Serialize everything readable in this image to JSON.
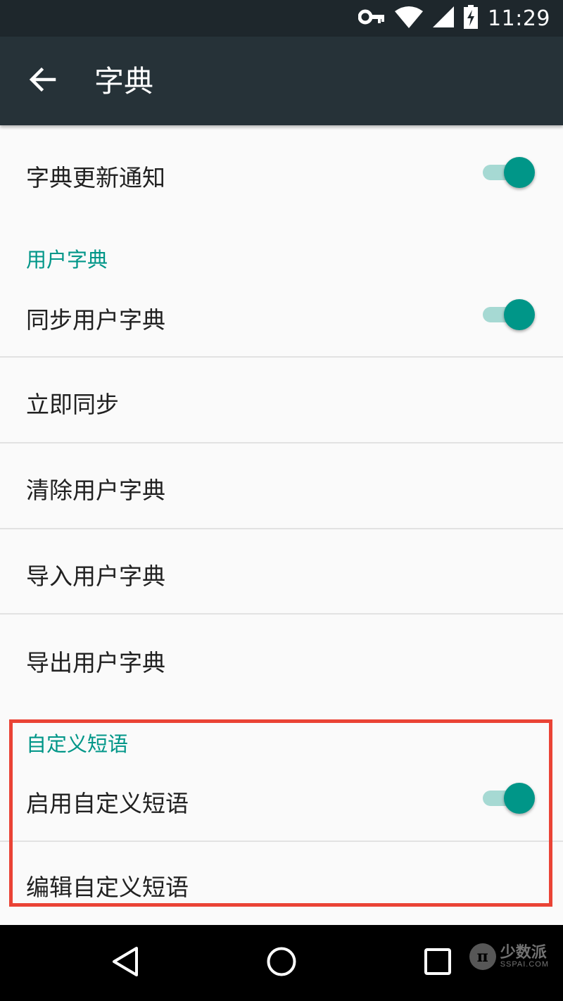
{
  "status_bar": {
    "time": "11:29",
    "icons": [
      "vpn-key-icon",
      "wifi-icon",
      "cell-signal-icon",
      "battery-charging-icon"
    ]
  },
  "app_bar": {
    "title": "字典",
    "back_icon": "arrow-back-icon"
  },
  "settings": {
    "dict_update_notify": {
      "label": "字典更新通知",
      "enabled": true
    },
    "user_dict_section": "用户字典",
    "sync_user_dict": {
      "label": "同步用户字典",
      "enabled": true
    },
    "sync_now": {
      "label": "立即同步"
    },
    "clear_user_dict": {
      "label": "清除用户字典"
    },
    "import_user_dict": {
      "label": "导入用户字典"
    },
    "export_user_dict": {
      "label": "导出用户字典"
    },
    "custom_phrase_section": "自定义短语",
    "enable_custom_phrase": {
      "label": "启用自定义短语",
      "enabled": true
    },
    "edit_custom_phrase": {
      "label": "编辑自定义短语"
    }
  },
  "nav_bar": {
    "icons": [
      "back-triangle-icon",
      "home-circle-icon",
      "recents-square-icon"
    ]
  },
  "watermark": {
    "cn": "少数派",
    "en": "SSPAI.COM",
    "badge": "π"
  },
  "colors": {
    "accent": "#009688",
    "toolbar": "#263238",
    "status_bar": "#1e272c",
    "highlight": "#ea4335"
  }
}
